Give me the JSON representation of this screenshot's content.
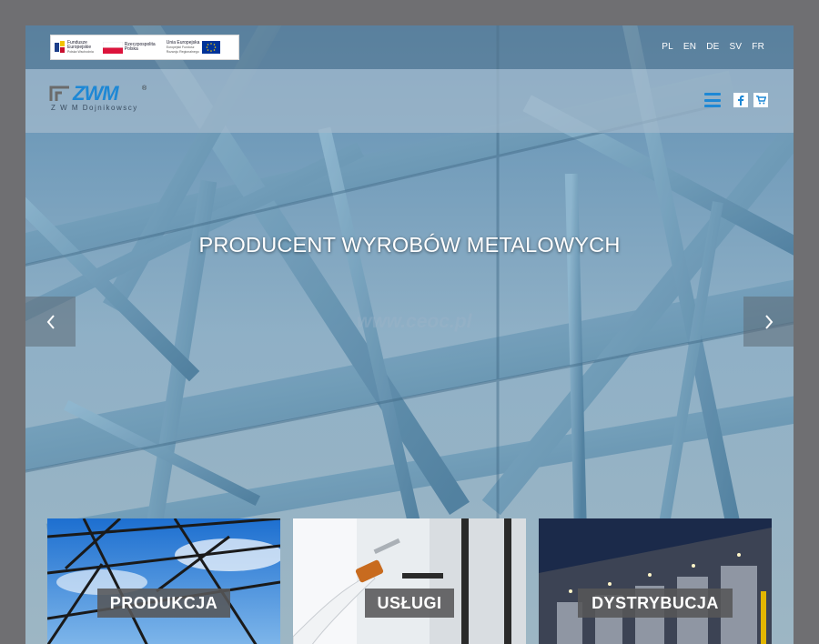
{
  "eu_banner": {
    "logo1_line1": "Fundusze",
    "logo1_line2": "Europejskie",
    "logo1_small": "Polska Wschodnia",
    "logo2_line1": "Rzeczpospolita",
    "logo2_line2": "Polska",
    "logo3_line1": "Unia Europejska",
    "logo3_small1": "Europejski Fundusz",
    "logo3_small2": "Rozwoju Regionalnego"
  },
  "languages": [
    "PL",
    "EN",
    "DE",
    "SV",
    "FR"
  ],
  "header": {
    "logo_text": "ZWM",
    "logo_reg": "®",
    "logo_subtitle": "Z W M Dojnikowscy",
    "menu_icon": "hamburger-menu-icon",
    "social_icon": "facebook-icon",
    "cart_icon": "shopping-cart-icon"
  },
  "slider": {
    "headline": "PRODUCENT WYROBÓW METALOWYCH",
    "watermark": "www.ceoc.pl",
    "prev_icon": "chevron-left-icon",
    "next_icon": "chevron-right-icon"
  },
  "tiles": [
    {
      "label": "PRODUKCJA"
    },
    {
      "label": "USŁUGI"
    },
    {
      "label": "DYSTRYBUCJA"
    }
  ],
  "colors": {
    "accent": "#1e88d5",
    "tile_label_bg": "#565658",
    "page_frame": "#6f6f72"
  }
}
